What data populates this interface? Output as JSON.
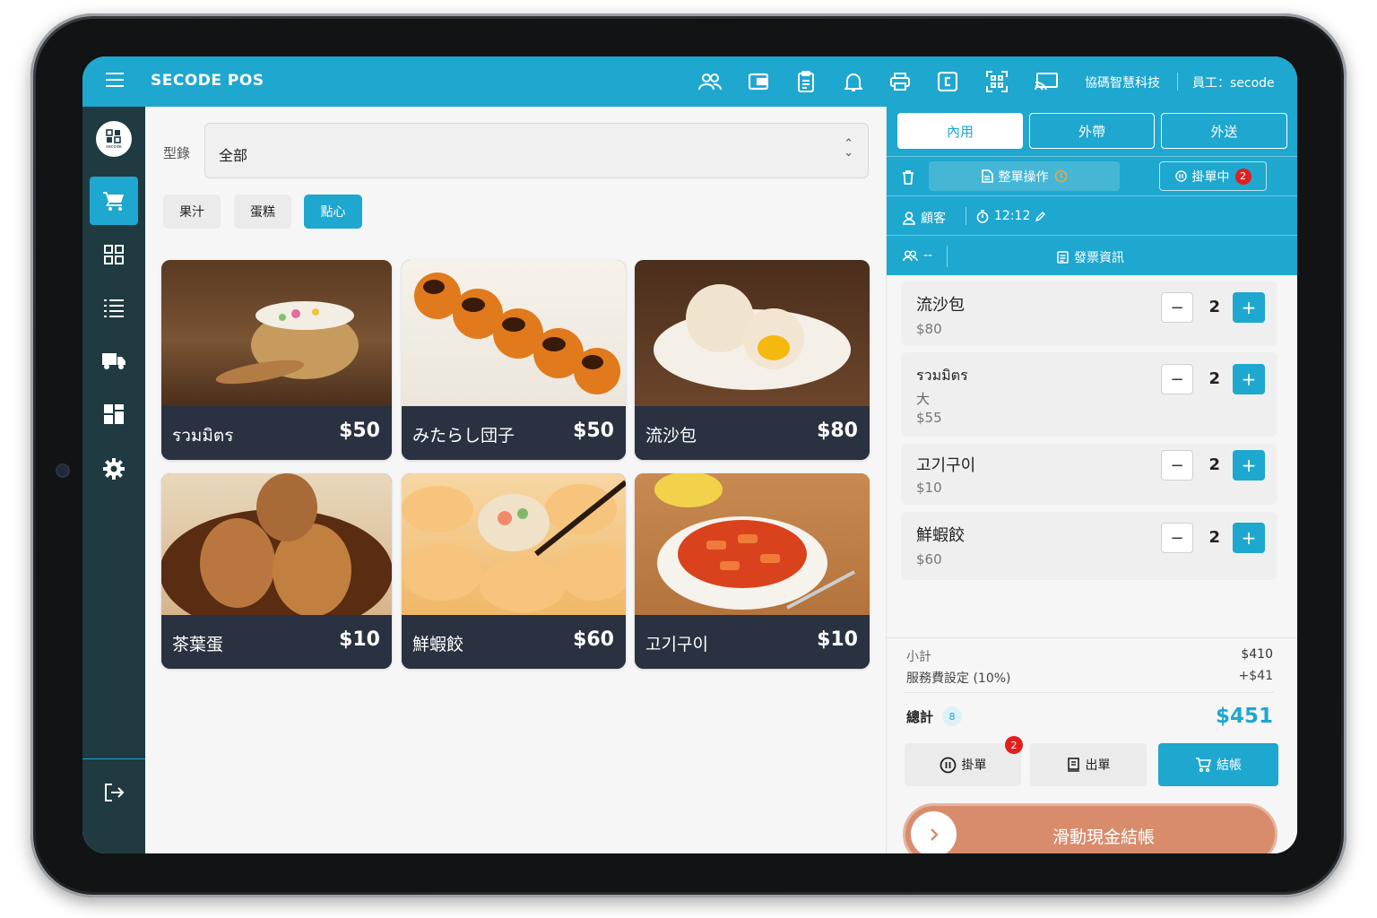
{
  "app": {
    "title": "SECODE POS"
  },
  "topbar": {
    "company": "協碼智慧科技",
    "staff": "員工：secode",
    "icons": [
      "users-icon",
      "wallet-icon",
      "clipboard-icon",
      "bell-icon",
      "printer-icon",
      "register-icon",
      "qr-code-icon",
      "cast-icon"
    ]
  },
  "sidebar": {
    "logo_text": "secode",
    "items": [
      "cart-icon",
      "grid-icon",
      "list-icon",
      "truck-icon",
      "dashboard-icon",
      "settings-icon"
    ],
    "logout": "logout-icon"
  },
  "catalog": {
    "label": "型錄",
    "selected": "全部",
    "chips": [
      "果汁",
      "蛋糕",
      "點心"
    ],
    "active_chip": "點心",
    "products": [
      {
        "name": "รวมมิตร",
        "price": "$50"
      },
      {
        "name": "みたらし団子",
        "price": "$50"
      },
      {
        "name": "流沙包",
        "price": "$80"
      },
      {
        "name": "茶葉蛋",
        "price": "$10"
      },
      {
        "name": "鮮蝦餃",
        "price": "$60"
      },
      {
        "name": "고기구이",
        "price": "$10"
      }
    ]
  },
  "order": {
    "tabs": [
      "內用",
      "外帶",
      "外送"
    ],
    "active_tab": "內用",
    "bulk_action": "整單操作",
    "hold_list": "掛單中",
    "hold_count": "2",
    "customer": "顧客",
    "time": "12:12",
    "guests": "--",
    "invoice": "發票資訊",
    "items": [
      {
        "name": "流沙包",
        "note": "",
        "price": "$80",
        "qty": "2"
      },
      {
        "name": "รวมมิตร",
        "note": "大",
        "price": "$55",
        "qty": "2"
      },
      {
        "name": "고기구이",
        "note": "",
        "price": "$10",
        "qty": "2"
      },
      {
        "name": "鮮蝦餃",
        "note": "",
        "price": "$60",
        "qty": "2"
      }
    ],
    "subtotal_label": "小計",
    "subtotal": "$410",
    "service_label": "服務費設定 (10%)",
    "service": "+$41",
    "total_label": "總計",
    "total_count": "8",
    "total": "$451",
    "hold_btn": "掛單",
    "hold_btn_badge": "2",
    "print_btn": "出單",
    "checkout_btn": "結帳",
    "slide_text": "滑動現金結帳"
  },
  "colors": {
    "accent": "#1ea7cf",
    "sidebar": "#1f3a40",
    "card": "#2a3140",
    "slide": "#d88c6b",
    "badge": "#e0201f"
  }
}
